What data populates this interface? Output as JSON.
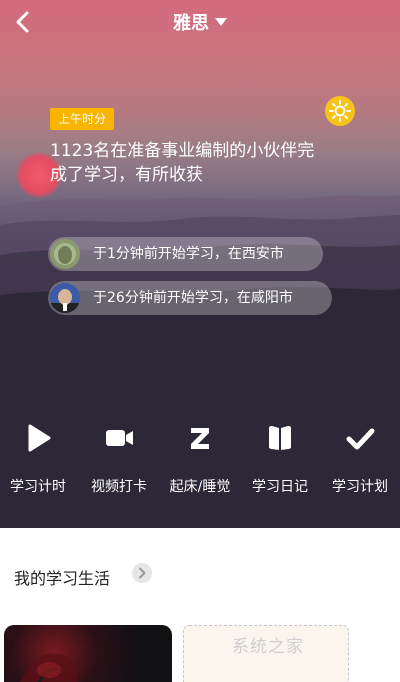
{
  "header": {
    "title": "雅思"
  },
  "hero": {
    "time_tag": "上午时分",
    "headline": "1123名在准备事业编制的小伙伴完成了学习，有所收获",
    "activities": [
      {
        "text": "于1分钟前开始学习，在西安市"
      },
      {
        "text": "于26分钟前开始学习，在咸阳市"
      }
    ]
  },
  "tools": [
    {
      "label": "学习计时",
      "icon": "play-icon"
    },
    {
      "label": "视频打卡",
      "icon": "video-camera-icon"
    },
    {
      "label": "起床/睡觉",
      "icon": "z-sleep-icon"
    },
    {
      "label": "学习日记",
      "icon": "book-icon"
    },
    {
      "label": "学习计划",
      "icon": "checkmark-icon"
    }
  ],
  "life": {
    "title": "我的学习生活"
  },
  "watermark": "系统之家",
  "colors": {
    "accent": "#f7b500",
    "sun_button": "#f7c318"
  }
}
